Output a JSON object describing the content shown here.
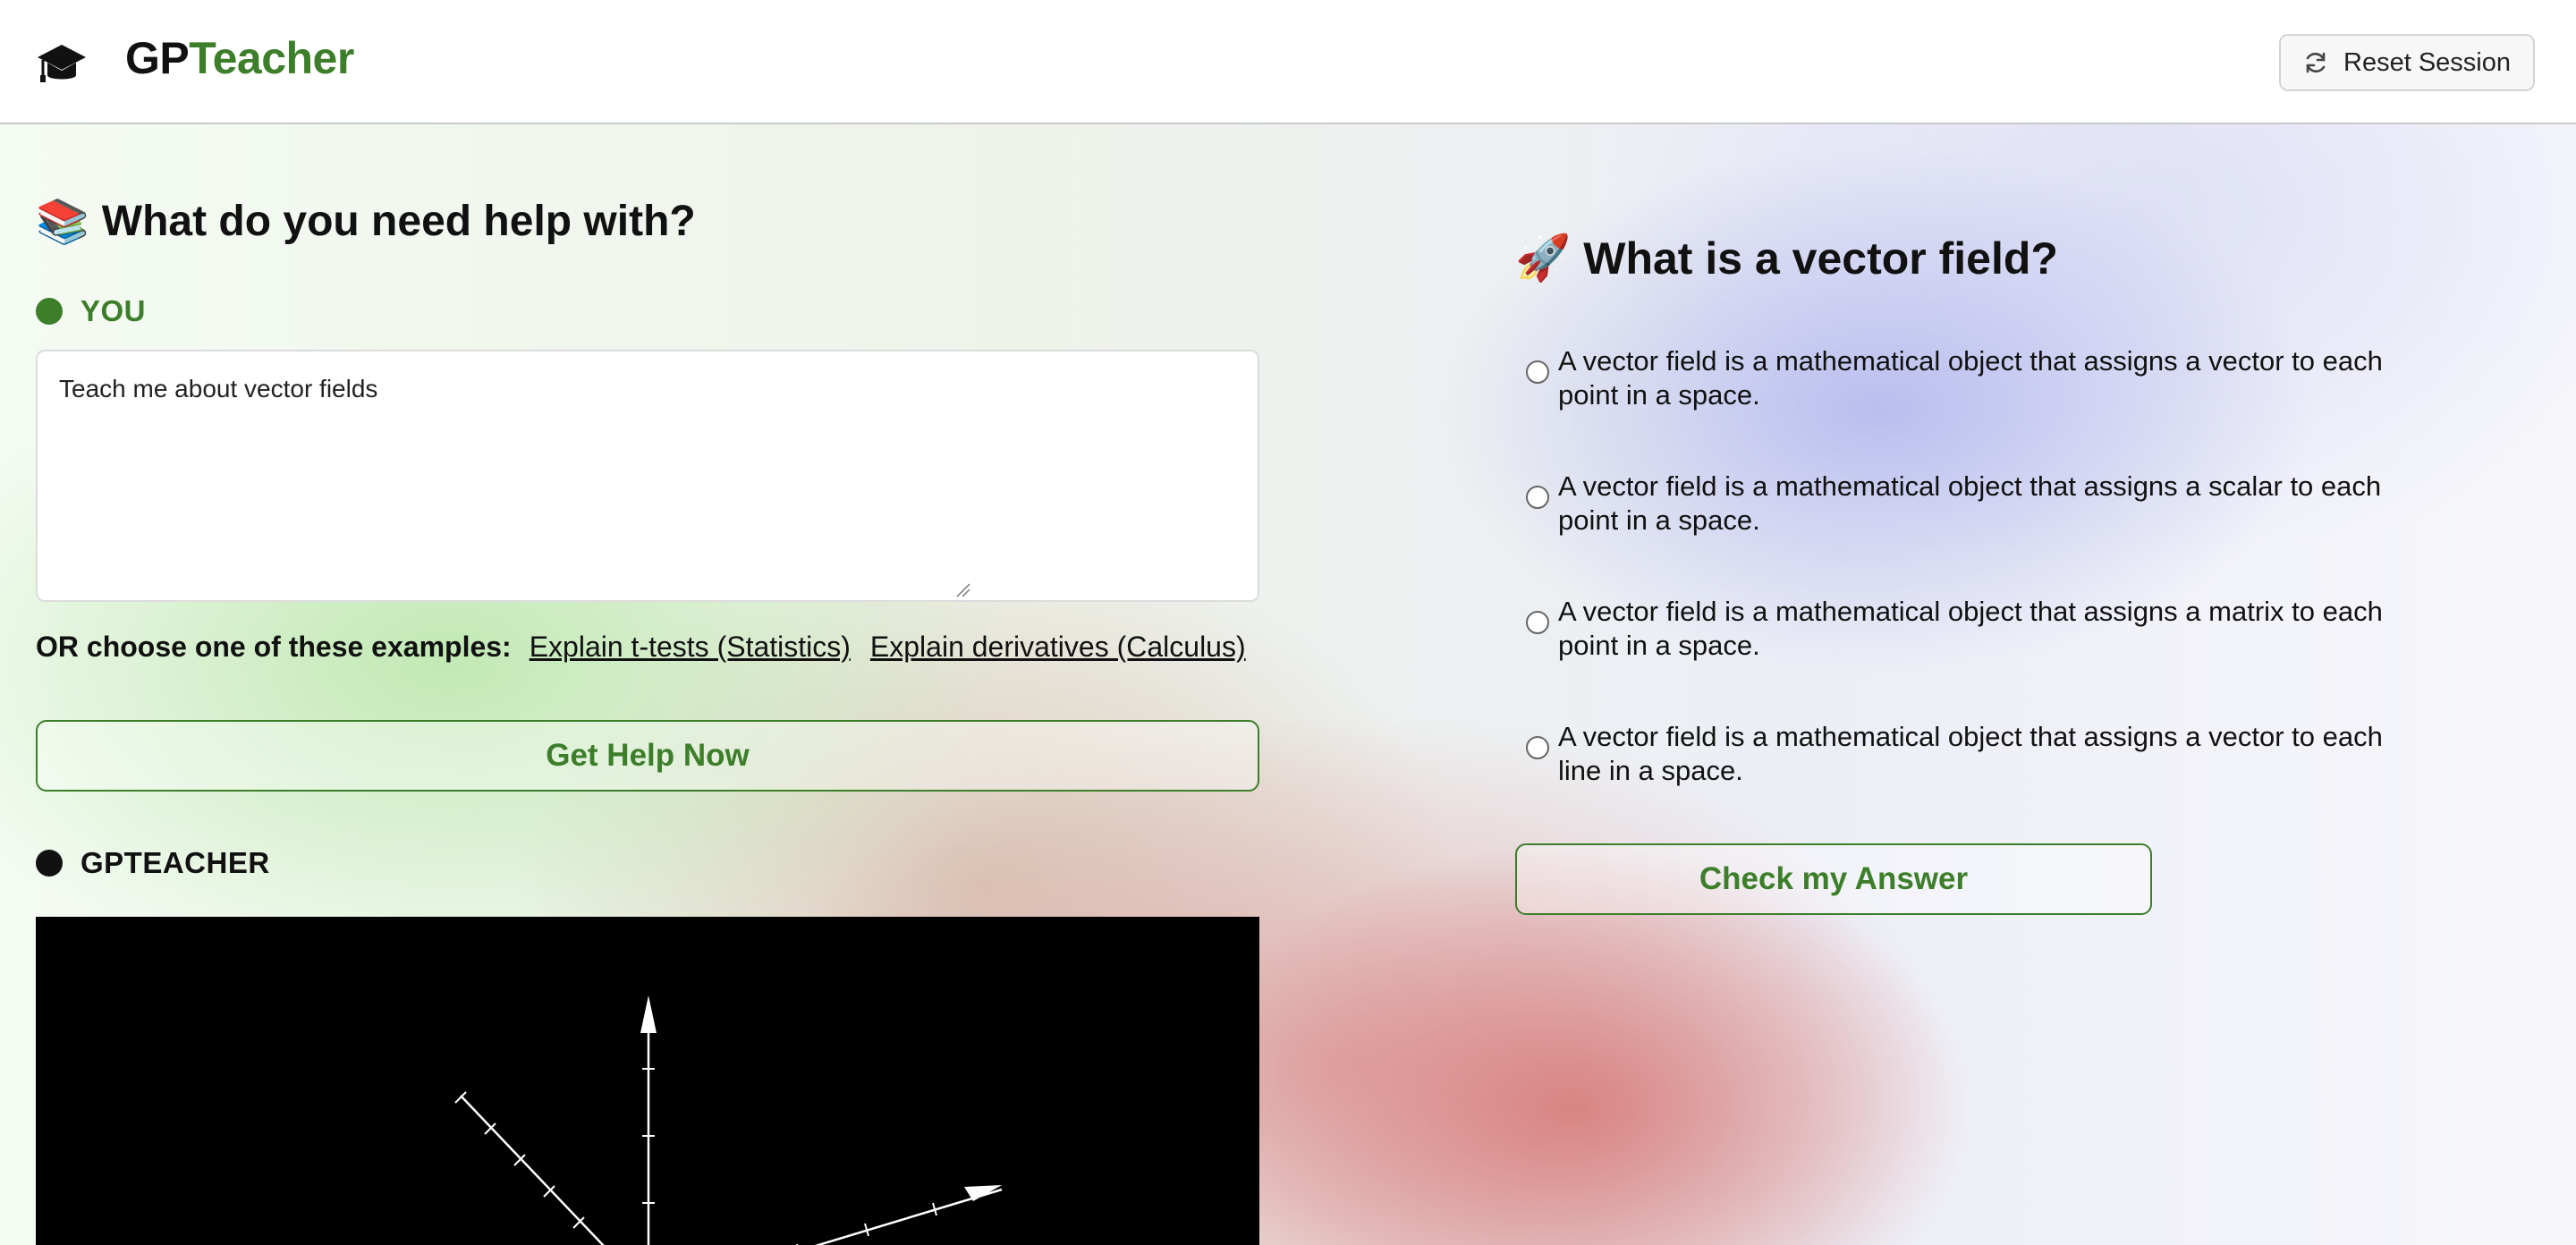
{
  "header": {
    "brand_part1": "GP",
    "brand_part2": "Teacher",
    "reset_label": "Reset Session"
  },
  "left": {
    "title_emoji": "📚",
    "title": "What do you need help with?",
    "you_label": "YOU",
    "prompt_value": "Teach me about vector fields",
    "examples_label": "OR choose one of these examples:",
    "examples": [
      "Explain t-tests (Statistics)",
      "Explain derivatives (Calculus)"
    ],
    "help_button": "Get Help Now",
    "assistant_label": "GPTEACHER"
  },
  "quiz": {
    "title_emoji": "🚀",
    "question": "What is a vector field?",
    "options": [
      "A vector field is a mathematical object that assigns a vector to each point in a space.",
      "A vector field is a mathematical object that assigns a scalar to each point in a space.",
      "A vector field is a mathematical object that assigns a matrix to each point in a space.",
      "A vector field is a mathematical object that assigns a vector to each line in a space."
    ],
    "check_button": "Check my Answer"
  },
  "colors": {
    "brand_green": "#3d7e2a",
    "text": "#111111",
    "canvas_bg": "#000000"
  },
  "icons": [
    "graduation-cap-icon",
    "refresh-icon",
    "books-emoji",
    "rocket-emoji"
  ]
}
